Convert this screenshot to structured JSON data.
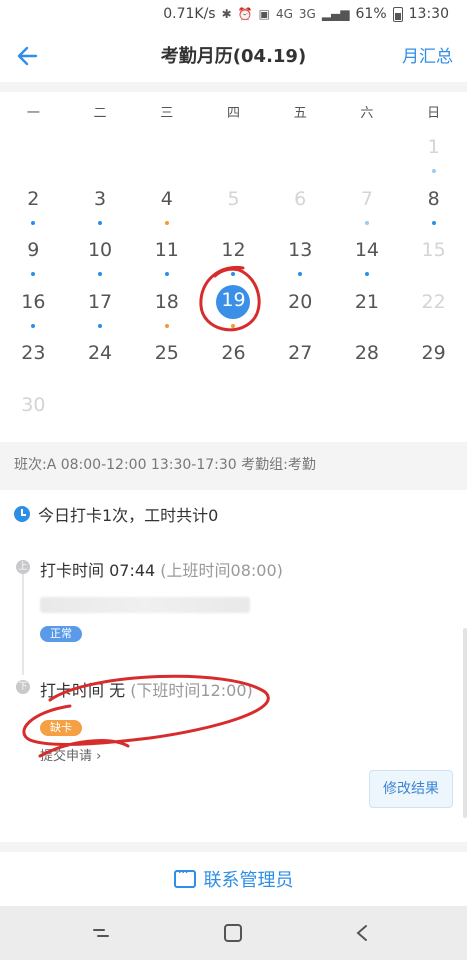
{
  "status_bar": {
    "speed": "0.71K/s",
    "network1": "4G",
    "network2": "3G",
    "battery": "61%",
    "time": "13:30"
  },
  "header": {
    "title": "考勤月历(04.19)",
    "summary_link": "月汇总"
  },
  "calendar": {
    "weekdays": [
      "一",
      "二",
      "三",
      "四",
      "五",
      "六",
      "日"
    ],
    "days": [
      {
        "n": "",
        "dot": "",
        "dim": false
      },
      {
        "n": "",
        "dot": "",
        "dim": false
      },
      {
        "n": "",
        "dot": "",
        "dim": false
      },
      {
        "n": "",
        "dot": "",
        "dim": false
      },
      {
        "n": "",
        "dot": "",
        "dim": false
      },
      {
        "n": "",
        "dot": "",
        "dim": false
      },
      {
        "n": "1",
        "dot": "light",
        "dim": true
      },
      {
        "n": "2",
        "dot": "blue",
        "dim": false
      },
      {
        "n": "3",
        "dot": "blue",
        "dim": false
      },
      {
        "n": "4",
        "dot": "orange",
        "dim": false
      },
      {
        "n": "5",
        "dot": "",
        "dim": true
      },
      {
        "n": "6",
        "dot": "",
        "dim": true
      },
      {
        "n": "7",
        "dot": "light",
        "dim": true
      },
      {
        "n": "8",
        "dot": "blue",
        "dim": false
      },
      {
        "n": "9",
        "dot": "blue",
        "dim": false
      },
      {
        "n": "10",
        "dot": "blue",
        "dim": false
      },
      {
        "n": "11",
        "dot": "blue",
        "dim": false
      },
      {
        "n": "12",
        "dot": "blue",
        "dim": false
      },
      {
        "n": "13",
        "dot": "blue",
        "dim": false
      },
      {
        "n": "14",
        "dot": "blue",
        "dim": false
      },
      {
        "n": "15",
        "dot": "",
        "dim": true
      },
      {
        "n": "16",
        "dot": "blue",
        "dim": false
      },
      {
        "n": "17",
        "dot": "blue",
        "dim": false
      },
      {
        "n": "18",
        "dot": "orange",
        "dim": false
      },
      {
        "n": "19",
        "dot": "orange",
        "dim": false,
        "selected": true
      },
      {
        "n": "20",
        "dot": "",
        "dim": false
      },
      {
        "n": "21",
        "dot": "",
        "dim": false
      },
      {
        "n": "22",
        "dot": "",
        "dim": true
      },
      {
        "n": "23",
        "dot": "",
        "dim": false
      },
      {
        "n": "24",
        "dot": "",
        "dim": false
      },
      {
        "n": "25",
        "dot": "",
        "dim": false
      },
      {
        "n": "26",
        "dot": "",
        "dim": false
      },
      {
        "n": "27",
        "dot": "",
        "dim": false
      },
      {
        "n": "28",
        "dot": "",
        "dim": false
      },
      {
        "n": "29",
        "dot": "",
        "dim": false
      },
      {
        "n": "30",
        "dot": "",
        "dim": true
      }
    ]
  },
  "shift_info": "班次:A 08:00-12:00 13:30-17:30 考勤组:考勤",
  "today_summary": "今日打卡1次，工时共计0",
  "punches": [
    {
      "badge": "上",
      "title": "打卡时间 07:44",
      "sub": "(上班时间08:00)",
      "tag": "正常"
    },
    {
      "badge": "下",
      "title": "打卡时间 无",
      "sub": "(下班时间12:00)",
      "tag": "缺卡",
      "action": "提交申请"
    }
  ],
  "modify_button": "修改结果",
  "contact_button": "联系管理员",
  "colors": {
    "accent": "#2f8fe6",
    "warning": "#f39a32"
  }
}
